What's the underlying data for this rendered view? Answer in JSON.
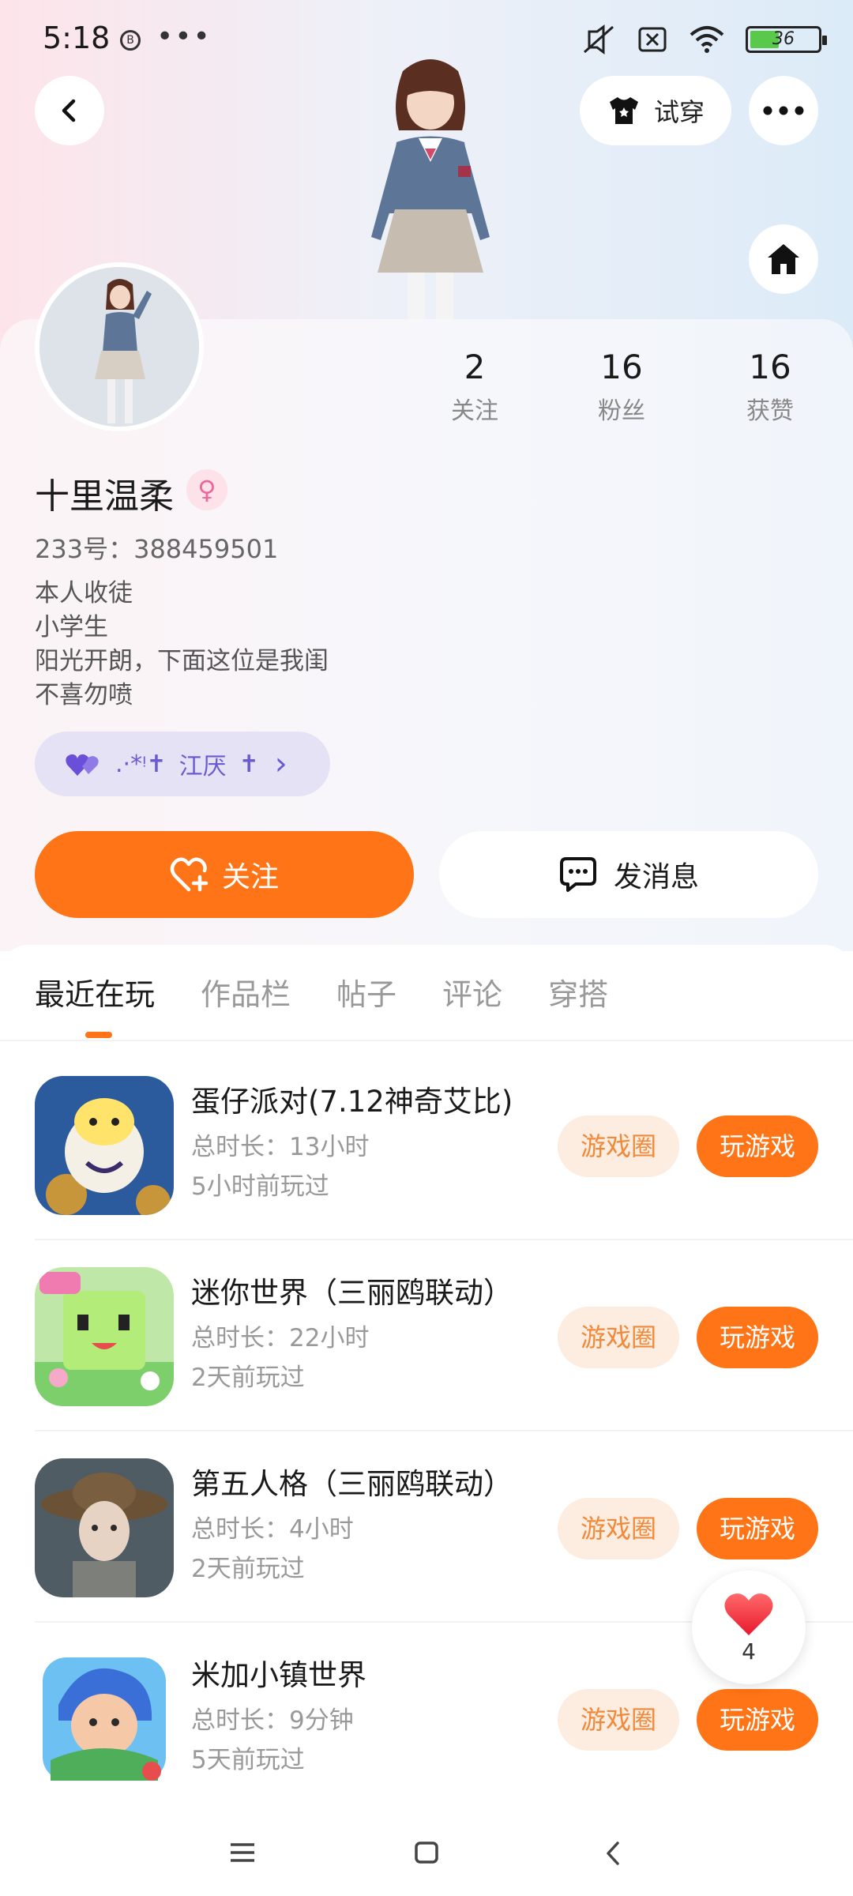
{
  "status_bar": {
    "time": "5:18",
    "app_icon_glyph": "B",
    "dots": "•••",
    "battery_level": "36"
  },
  "header": {
    "try_on_label": "试穿",
    "more_icon": "more-icon",
    "home_icon": "home-icon",
    "back_icon": "back-arrow-icon"
  },
  "profile": {
    "stats": [
      {
        "value": "2",
        "label": "关注"
      },
      {
        "value": "16",
        "label": "粉丝"
      },
      {
        "value": "16",
        "label": "获赞"
      }
    ],
    "username": "十里温柔",
    "gender_symbol": "♀",
    "uid": "233号：388459501",
    "bio": [
      "本人收徒",
      "小学生",
      "阳光开朗，下面这位是我闺",
      "不喜勿喷"
    ],
    "friend_tag": {
      "decor": ".·*ᵎ✝",
      "name": "江厌",
      "cross": "✝",
      "chevron": "›"
    }
  },
  "actions": {
    "follow_label": "关注",
    "message_label": "发消息"
  },
  "tabs": [
    "最近在玩",
    "作品栏",
    "帖子",
    "评论",
    "穿搭"
  ],
  "games": [
    {
      "title": "蛋仔派对(7.12神奇艾比)",
      "duration": "总时长：13小时",
      "last_played": "5小时前玩过",
      "circle_label": "游戏圈",
      "play_label": "玩游戏",
      "icon_colors": [
        "#3b6fb0",
        "#0f2a55"
      ]
    },
    {
      "title": "迷你世界（三丽鸥联动）",
      "duration": "总时长：22小时",
      "last_played": "2天前玩过",
      "circle_label": "游戏圈",
      "play_label": "玩游戏",
      "icon_colors": [
        "#7fd66f",
        "#f6a9c8"
      ]
    },
    {
      "title": "第五人格（三丽鸥联动）",
      "duration": "总时长：4小时",
      "last_played": "2天前玩过",
      "circle_label": "游戏圈",
      "play_label": "玩游戏",
      "icon_colors": [
        "#6f7c84",
        "#2f3a40"
      ]
    },
    {
      "title": "米加小镇世界",
      "duration": "总时长：9分钟",
      "last_played": "5天前玩过",
      "circle_label": "游戏圈",
      "play_label": "玩游戏",
      "icon_colors": [
        "#58b3ec",
        "#3f9a4a"
      ]
    }
  ],
  "like_float": {
    "count": "4"
  },
  "colors": {
    "accent": "#ff7416",
    "chip_bg": "#fdece0",
    "tag_bg": "#e6e2f6"
  }
}
